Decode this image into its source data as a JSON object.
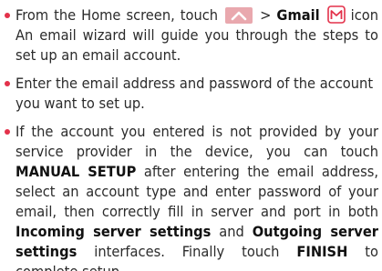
{
  "colors": {
    "bullet": "#e3314a",
    "text": "#2b2b2b",
    "launcher_icon_bg": "#e9a8ae",
    "gmail_icon_border": "#e3314a"
  },
  "icons": {
    "launcher": "launcher-chevron-up-icon",
    "gmail": "gmail-envelope-icon"
  },
  "bullets": [
    {
      "part1": "From the Home screen, touch",
      "gt": ">",
      "gmail": "Gmail",
      "part2": "icon An email wizard will guide you through the steps to set up an email account."
    },
    {
      "text": "Enter the email address and password of the account you want to set up."
    },
    {
      "part1": "If the account you entered is not provided by your service provider in the device, you can touch",
      "manual_setup": "MANUAL SETUP",
      "part2": "after entering the email address, select an account type and enter password of your email, then correctly fill in server and port in both",
      "incoming": "Incoming server settings",
      "and": "and",
      "outgoing": "Outgoing server settings",
      "part3": "interfaces.  Finally touch",
      "finish": "FINISH",
      "part4": "to complete setup."
    }
  ]
}
